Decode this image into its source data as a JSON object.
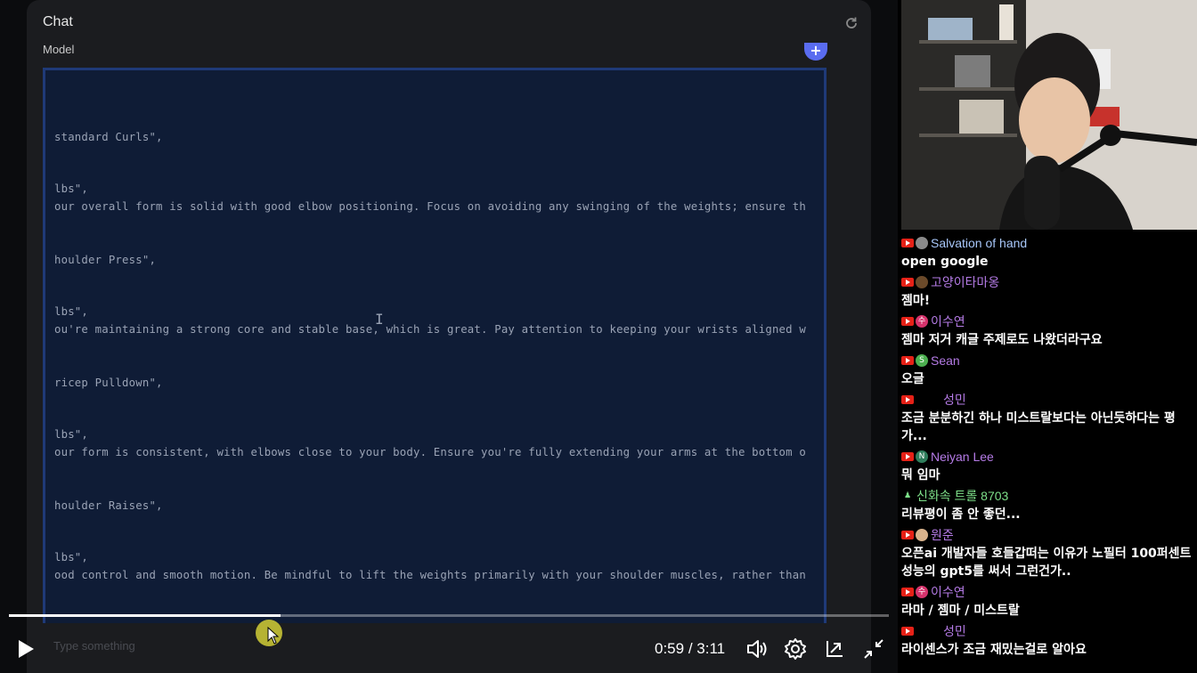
{
  "chat_panel": {
    "title": "Chat",
    "model_label": "Model",
    "plus_label": "+",
    "input_placeholder": "Type something"
  },
  "code_lines": [
    "standard Curls\",",
    "lbs\",",
    "our overall form is solid with good elbow positioning. Focus on avoiding any swinging of the weights; ensure th",
    "houlder Press\",",
    "lbs\",",
    "ou're maintaining a strong core and stable base, which is great. Pay attention to keeping your wrists aligned w",
    "ricep Pulldown\",",
    "lbs\",",
    "our form is consistent, with elbows close to your body. Ensure you're fully extending your arms at the bottom o",
    "houlder Raises\",",
    "lbs\",",
    "ood control and smooth motion. Be mindful to lift the weights primarily with your shoulder muscles, rather than"
  ],
  "player": {
    "current_time": "0:59",
    "separator": " / ",
    "duration": "3:11",
    "progress_fraction": 0.309
  },
  "live_chat": [
    {
      "author": "Salvation of hand",
      "author_color": "#a8c7fa",
      "avatar_color": "#8a8a8a",
      "avatar_glyph": "",
      "badge": true,
      "text": "open google"
    },
    {
      "author": "고양이타마옹",
      "author_color": "#b57be6",
      "avatar_color": "#6b4a2a",
      "avatar_glyph": "",
      "badge": true,
      "text": "젬마!"
    },
    {
      "author": "이수연",
      "author_color": "#b57be6",
      "avatar_color": "#d6336c",
      "avatar_glyph": "수",
      "badge": true,
      "text": "젬마 저거 캐글 주제로도 나왔더라구요"
    },
    {
      "author": "Sean",
      "author_color": "#b57be6",
      "avatar_color": "#4caf50",
      "avatar_glyph": "S",
      "badge": true,
      "text": "오글"
    },
    {
      "author": "성민",
      "author_color": "#b57be6",
      "avatar_color": "transparent",
      "avatar_glyph": "",
      "badge": true,
      "text": "조금 분분하긴 하나 미스트랄보다는 아닌듯하다는 평가..."
    },
    {
      "author": "Neiyan Lee",
      "author_color": "#b57be6",
      "avatar_color": "#2e7d5b",
      "avatar_glyph": "N",
      "badge": true,
      "text": "뭐 임마"
    },
    {
      "author": "신화속 트롤 8703",
      "author_color": "#7ee08a",
      "avatar_color": "transparent",
      "avatar_glyph": "♟",
      "badge": false,
      "text": "리뷰평이 좀 안 좋던..."
    },
    {
      "author": "원준",
      "author_color": "#b57be6",
      "avatar_color": "#d9b38c",
      "avatar_glyph": "",
      "badge": true,
      "text": "오픈ai 개발자들 호들갑떠는 이유가 노필터 100퍼센트 성능의 gpt5를 써서 그런건가.."
    },
    {
      "author": "이수연",
      "author_color": "#b57be6",
      "avatar_color": "#d6336c",
      "avatar_glyph": "수",
      "badge": true,
      "text": "라마 / 젬마 / 미스트랄"
    },
    {
      "author": "성민",
      "author_color": "#b57be6",
      "avatar_color": "transparent",
      "avatar_glyph": "",
      "badge": true,
      "text": "라이센스가 조금 재밌는걸로 알아요"
    }
  ]
}
